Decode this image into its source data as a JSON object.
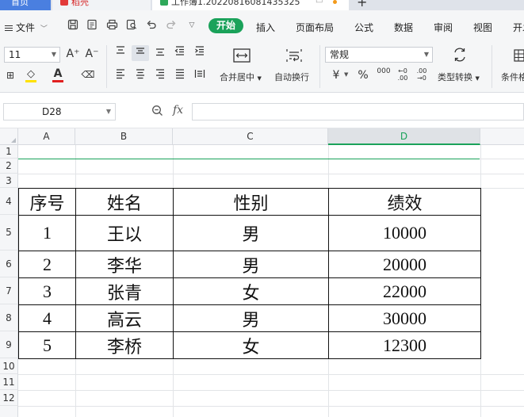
{
  "tabs": {
    "home_label": "首页",
    "dao_label": "稻壳",
    "workbook_title": "工作簿1.20220816081435325",
    "pin_glyph": "□",
    "add_glyph": "+"
  },
  "menu": {
    "file_label": "文件",
    "start_label": "开始",
    "items": [
      "插入",
      "页面布局",
      "公式",
      "数据",
      "审阅",
      "视图",
      "开发"
    ]
  },
  "ribbon": {
    "font_size": "11",
    "number_format": "常规",
    "merge_label": "合并居中",
    "wrap_label": "自动换行",
    "convert_label": "类型转换",
    "conditional_label": "条件格",
    "currency_glyph": "¥",
    "percent_glyph": "%",
    "thousands_glyph": "000",
    "inc_decimal_glyph": "←0 .00",
    "dec_decimal_glyph": ".00 →0",
    "grow_font_glyph": "A⁺",
    "shrink_font_glyph": "A⁻",
    "font_color_glyph": "A",
    "fill_glyph": "◇",
    "clear_glyph": "⌫",
    "border_glyph": "⊞",
    "accent_color": "#1aa25a",
    "font_color_bar": "#e02020",
    "fill_color_bar": "#ffe100"
  },
  "formula_bar": {
    "cell_ref": "D28",
    "fx_label": "fx",
    "formula_value": ""
  },
  "sheet": {
    "columns": [
      "A",
      "B",
      "C",
      "D"
    ],
    "rows": [
      "1",
      "2",
      "3",
      "4",
      "5",
      "6",
      "7",
      "8",
      "9",
      "10",
      "11",
      "12"
    ],
    "selected_column": "D",
    "table": {
      "headers": [
        "序号",
        "姓名",
        "性别",
        "绩效"
      ],
      "rows": [
        [
          "1",
          "王以",
          "男",
          "10000"
        ],
        [
          "2",
          "李华",
          "男",
          "20000"
        ],
        [
          "3",
          "张青",
          "女",
          "22000"
        ],
        [
          "4",
          "高云",
          "男",
          "30000"
        ],
        [
          "5",
          "李桥",
          "女",
          "12300"
        ]
      ]
    }
  }
}
